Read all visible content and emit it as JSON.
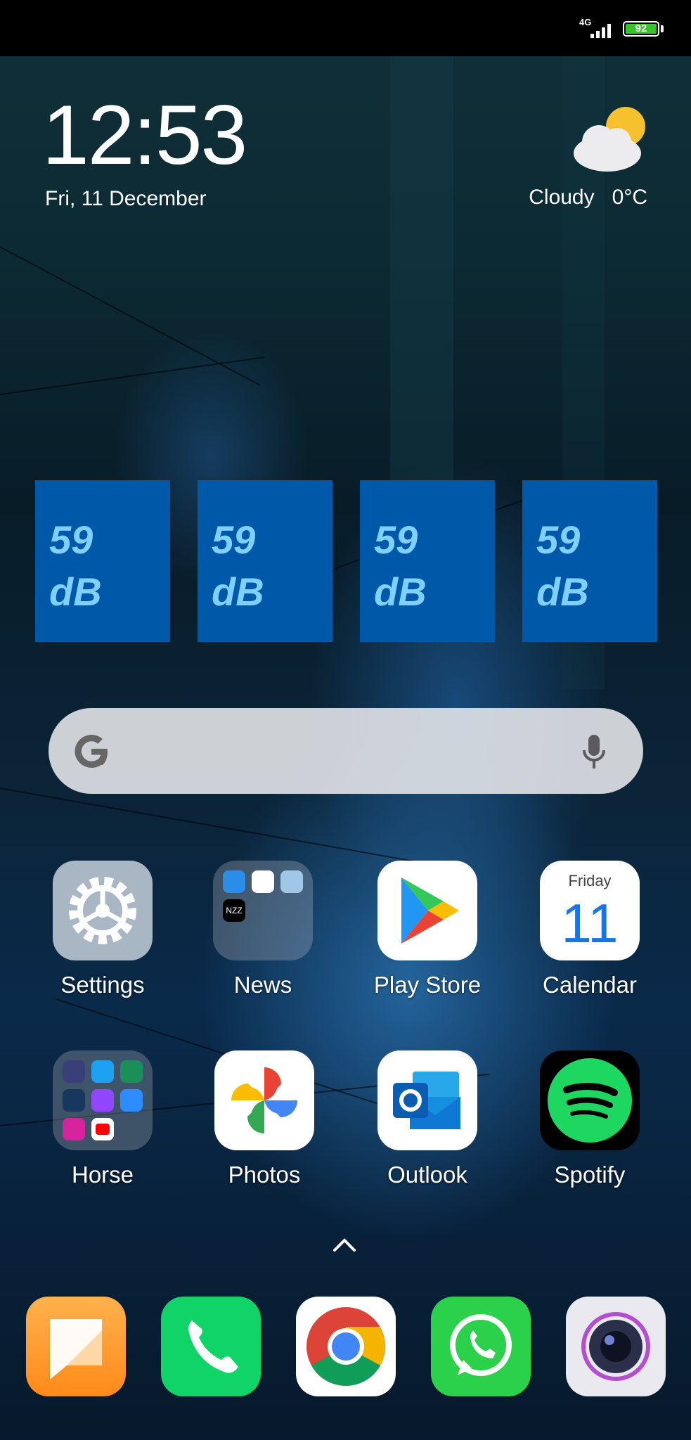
{
  "status_bar": {
    "network": "4G",
    "battery": "92"
  },
  "clock": {
    "time": "12:53",
    "date": "Fri, 11 December"
  },
  "weather": {
    "condition": "Cloudy",
    "temperature": "0°C",
    "icon": "partly-cloudy-icon"
  },
  "sound_widgets": [
    {
      "value": "59",
      "unit": "dB"
    },
    {
      "value": "59",
      "unit": "dB"
    },
    {
      "value": "59",
      "unit": "dB"
    },
    {
      "value": "59",
      "unit": "dB"
    }
  ],
  "search_bar": {
    "logo": "G",
    "icon": "microphone-icon"
  },
  "apps_row1": [
    {
      "label": "Settings",
      "icon": "gear-icon"
    },
    {
      "label": "News",
      "icon": "folder-icon",
      "folder_apps": [
        "news-app-1",
        "nyt-app",
        "weather-news-app",
        "NZZ"
      ]
    },
    {
      "label": "Play Store",
      "icon": "play-store-icon"
    },
    {
      "label": "Calendar",
      "icon": "calendar-icon",
      "day_name": "Friday",
      "day_number": "11"
    }
  ],
  "apps_row2": [
    {
      "label": "Horse",
      "icon": "folder-icon"
    },
    {
      "label": "Photos",
      "icon": "pinwheel-icon"
    },
    {
      "label": "Outlook",
      "icon": "outlook-icon"
    },
    {
      "label": "Spotify",
      "icon": "spotify-icon"
    }
  ],
  "dock": [
    {
      "name": "Messages",
      "icon": "message-icon",
      "color": "#ff9c2a"
    },
    {
      "name": "Phone",
      "icon": "phone-icon",
      "color": "#10d468"
    },
    {
      "name": "Chrome",
      "icon": "chrome-icon",
      "color": "#ffffff"
    },
    {
      "name": "WhatsApp",
      "icon": "whatsapp-icon",
      "color": "#2bd14b"
    },
    {
      "name": "Camera",
      "icon": "camera-icon",
      "color": "#e9e9ef"
    }
  ],
  "colors": {
    "widget_bg": "#0059a8",
    "widget_text": "#7fd0ff"
  }
}
